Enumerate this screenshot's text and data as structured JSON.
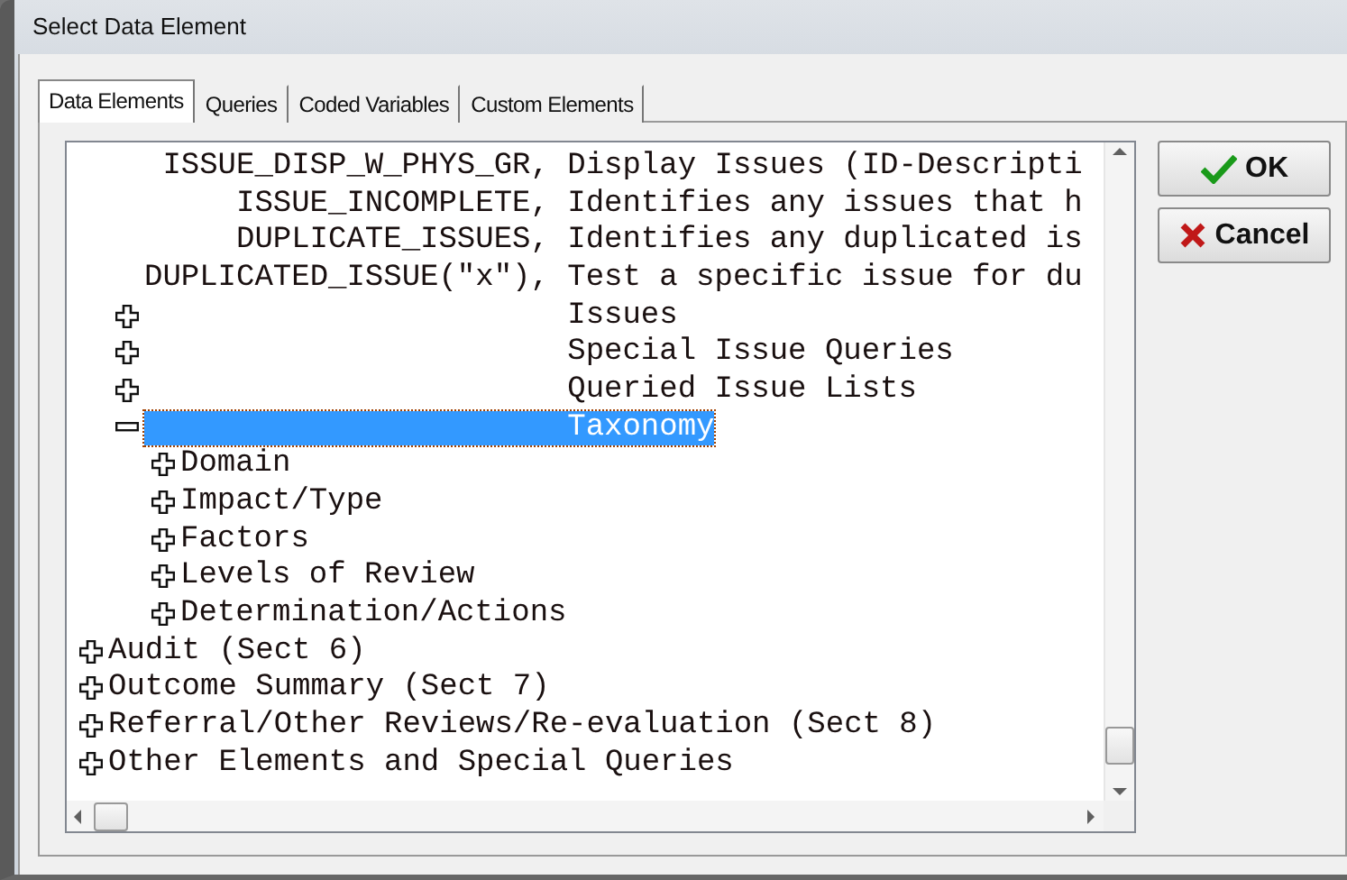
{
  "window": {
    "title": "Select Data Element"
  },
  "tabs": [
    {
      "label": "Data Elements",
      "selected": true
    },
    {
      "label": "Queries",
      "selected": false
    },
    {
      "label": "Coded Variables",
      "selected": false
    },
    {
      "label": "Custom Elements",
      "selected": false
    }
  ],
  "tree": {
    "scrolled_branch": {
      "children": [
        {
          "kind": "entry",
          "name": "ISSUE_DISP_W_PHYS_GR,",
          "description": "Display Issues (ID-Descripti",
          "selected": false
        },
        {
          "kind": "entry",
          "name": "ISSUE_INCOMPLETE,",
          "description": "Identifies any issues that h",
          "selected": false
        },
        {
          "kind": "entry",
          "name": "DUPLICATE_ISSUES,",
          "description": "Identifies any duplicated is",
          "selected": false
        },
        {
          "kind": "entry",
          "name": "DUPLICATED_ISSUE(\"x\"),",
          "description": "Test a specific issue for du",
          "selected": false
        },
        {
          "kind": "folder",
          "label": "Issues",
          "expanded": false,
          "selected": false
        },
        {
          "kind": "folder",
          "label": "Special Issue Queries",
          "expanded": false,
          "selected": false
        },
        {
          "kind": "folder",
          "label": "Queried Issue Lists",
          "expanded": false,
          "selected": false
        },
        {
          "kind": "folder",
          "label": "Taxonomy",
          "expanded": true,
          "selected": true,
          "children": [
            {
              "kind": "folder",
              "label": "Domain",
              "expanded": false,
              "selected": false
            },
            {
              "kind": "folder",
              "label": "Impact/Type",
              "expanded": false,
              "selected": false
            },
            {
              "kind": "folder",
              "label": "Factors",
              "expanded": false,
              "selected": false
            },
            {
              "kind": "folder",
              "label": "Levels of Review",
              "expanded": false,
              "selected": false
            },
            {
              "kind": "folder",
              "label": "Determination/Actions",
              "expanded": false,
              "selected": false
            }
          ]
        }
      ]
    },
    "items": [
      {
        "kind": "folder",
        "label": "Audit (Sect 6)",
        "expanded": false,
        "selected": false
      },
      {
        "kind": "folder",
        "label": "Outcome Summary (Sect 7)",
        "expanded": false,
        "selected": false
      },
      {
        "kind": "folder",
        "label": "Referral/Other Reviews/Re-evaluation (Sect 8)",
        "expanded": false,
        "selected": false
      },
      {
        "kind": "folder",
        "label": "Other Elements and Special Queries",
        "expanded": false,
        "selected": false
      }
    ]
  },
  "buttons": [
    {
      "kind": "ok",
      "label": "OK"
    },
    {
      "kind": "cancel",
      "label": "Cancel"
    }
  ]
}
